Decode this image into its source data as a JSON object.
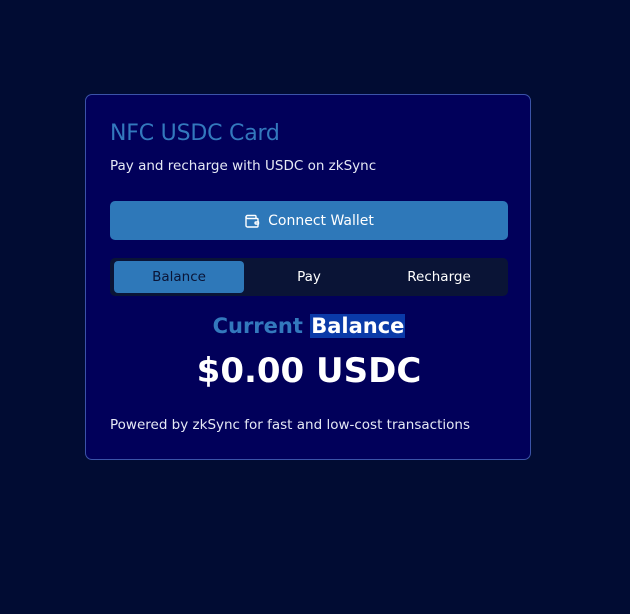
{
  "card": {
    "title": "NFC USDC Card",
    "subtitle": "Pay and recharge with USDC on zkSync",
    "connect_button": {
      "label": "Connect Wallet",
      "icon": "wallet-icon"
    },
    "tabs": [
      {
        "label": "Balance",
        "active": true
      },
      {
        "label": "Pay",
        "active": false
      },
      {
        "label": "Recharge",
        "active": false
      }
    ],
    "balance": {
      "label_prefix": "Current",
      "label_highlight": "Balance",
      "value": "$0.00 USDC"
    },
    "footer": "Powered by zkSync for fast and low-cost transactions"
  },
  "colors": {
    "page_background": "#010c33",
    "card_background": "#01005a",
    "accent": "#2e78b9",
    "title": "#3379bd"
  }
}
